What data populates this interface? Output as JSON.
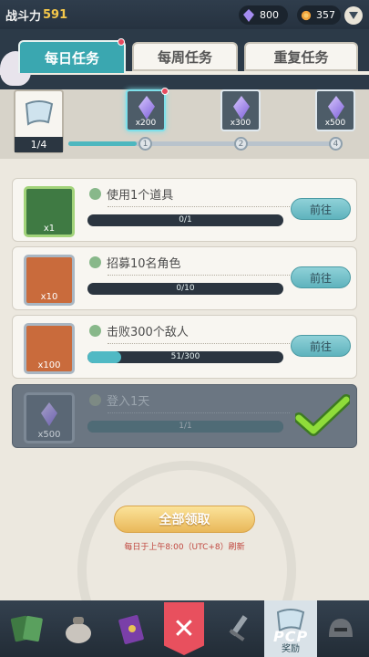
{
  "header": {
    "power_label": "战斗力",
    "power_value": "591",
    "gem_count": "800",
    "coin_count": "357"
  },
  "tabs": [
    {
      "label": "每日任务",
      "active": true,
      "has_badge": true
    },
    {
      "label": "每周任务",
      "active": false,
      "has_badge": false
    },
    {
      "label": "重复任务",
      "active": false,
      "has_badge": false
    }
  ],
  "progress": {
    "count": "1/4",
    "fraction": 0.25,
    "rewards": [
      {
        "qty": "x200",
        "node": "1",
        "active": true,
        "has_badge": true
      },
      {
        "qty": "x300",
        "node": "2",
        "active": false,
        "has_badge": false
      },
      {
        "qty": "x500",
        "node": "4",
        "active": false,
        "has_badge": false
      }
    ]
  },
  "tasks": [
    {
      "title": "使用1个道具",
      "reward_qty": "x1",
      "progress": "0/1",
      "fraction": 0,
      "button": "前往",
      "completed": false,
      "icon": "toolbox-icon"
    },
    {
      "title": "招募10名角色",
      "reward_qty": "x10",
      "progress": "0/10",
      "fraction": 0,
      "button": "前往",
      "completed": false,
      "icon": "ticket-icon"
    },
    {
      "title": "击败300个敌人",
      "reward_qty": "x100",
      "progress": "51/300",
      "fraction": 0.17,
      "button": "前往",
      "completed": false,
      "icon": "ticket-icon"
    },
    {
      "title": "登入1天",
      "reward_qty": "x500",
      "progress": "1/1",
      "fraction": 1,
      "button": "",
      "completed": true,
      "icon": "gem-icon"
    }
  ],
  "claim_all_label": "全部领取",
  "reset_note": "每日于上午8:00（UTC+8）刷新",
  "nav": {
    "active_label": "奖励",
    "watermark": "PCP"
  },
  "colors": {
    "accent": "#3aa7b0",
    "claim": "#e9b85a",
    "close": "#e8505e"
  }
}
